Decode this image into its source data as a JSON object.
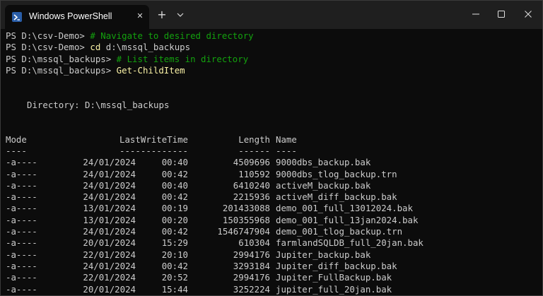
{
  "window": {
    "tab_title": "Windows PowerShell",
    "tab_close_glyph": "✕",
    "new_tab_glyph": "+"
  },
  "console": {
    "lines": [
      {
        "prompt": "PS D:\\csv-Demo> ",
        "command": "",
        "args": "",
        "comment": "# Navigate to desired directory"
      },
      {
        "prompt": "PS D:\\csv-Demo> ",
        "command": "cd",
        "args": " d:\\mssql_backups",
        "comment": ""
      },
      {
        "prompt": "PS D:\\mssql_backups> ",
        "command": "",
        "args": "",
        "comment": "# List items in directory"
      },
      {
        "prompt": "PS D:\\mssql_backups> ",
        "command": "Get-ChildItem",
        "args": "",
        "comment": ""
      }
    ],
    "directory_line": "Directory: D:\\mssql_backups",
    "headers": {
      "mode": "Mode",
      "lastwritetime": "LastWriteTime",
      "length": "Length",
      "name": "Name"
    },
    "underlines": {
      "mode": "----",
      "lastwritetime": "-------------",
      "length": "------",
      "name": "----"
    },
    "rows": [
      {
        "mode": "-a----",
        "date": "24/01/2024",
        "time": "00:40",
        "length": "4509696",
        "name": "9000dbs_backup.bak"
      },
      {
        "mode": "-a----",
        "date": "24/01/2024",
        "time": "00:42",
        "length": "110592",
        "name": "9000dbs_tlog_backup.trn"
      },
      {
        "mode": "-a----",
        "date": "24/01/2024",
        "time": "00:40",
        "length": "6410240",
        "name": "activeM_backup.bak"
      },
      {
        "mode": "-a----",
        "date": "24/01/2024",
        "time": "00:42",
        "length": "2215936",
        "name": "activeM_diff_backup.bak"
      },
      {
        "mode": "-a----",
        "date": "13/01/2024",
        "time": "00:19",
        "length": "201433088",
        "name": "demo_001_full_13012024.bak"
      },
      {
        "mode": "-a----",
        "date": "13/01/2024",
        "time": "00:20",
        "length": "150355968",
        "name": "demo_001_full_13jan2024.bak"
      },
      {
        "mode": "-a----",
        "date": "24/01/2024",
        "time": "00:42",
        "length": "1546747904",
        "name": "demo_001_tlog_backup.trn"
      },
      {
        "mode": "-a----",
        "date": "20/01/2024",
        "time": "15:29",
        "length": "610304",
        "name": "farmlandSQLDB_full_20jan.bak"
      },
      {
        "mode": "-a----",
        "date": "22/01/2024",
        "time": "20:10",
        "length": "2994176",
        "name": "Jupiter_backup.bak"
      },
      {
        "mode": "-a----",
        "date": "24/01/2024",
        "time": "00:42",
        "length": "3293184",
        "name": "Jupiter_diff_backup.bak"
      },
      {
        "mode": "-a----",
        "date": "22/01/2024",
        "time": "20:52",
        "length": "2994176",
        "name": "Jupiter_FullBackup.bak"
      },
      {
        "mode": "-a----",
        "date": "20/01/2024",
        "time": "15:44",
        "length": "3252224",
        "name": "jupiter_full_20jan.bak"
      }
    ]
  },
  "colors": {
    "background": "#0c0c0c",
    "titlebar": "#1f1f1f",
    "text": "#cccccc",
    "command": "#f9f1a5",
    "comment": "#13a10e"
  }
}
